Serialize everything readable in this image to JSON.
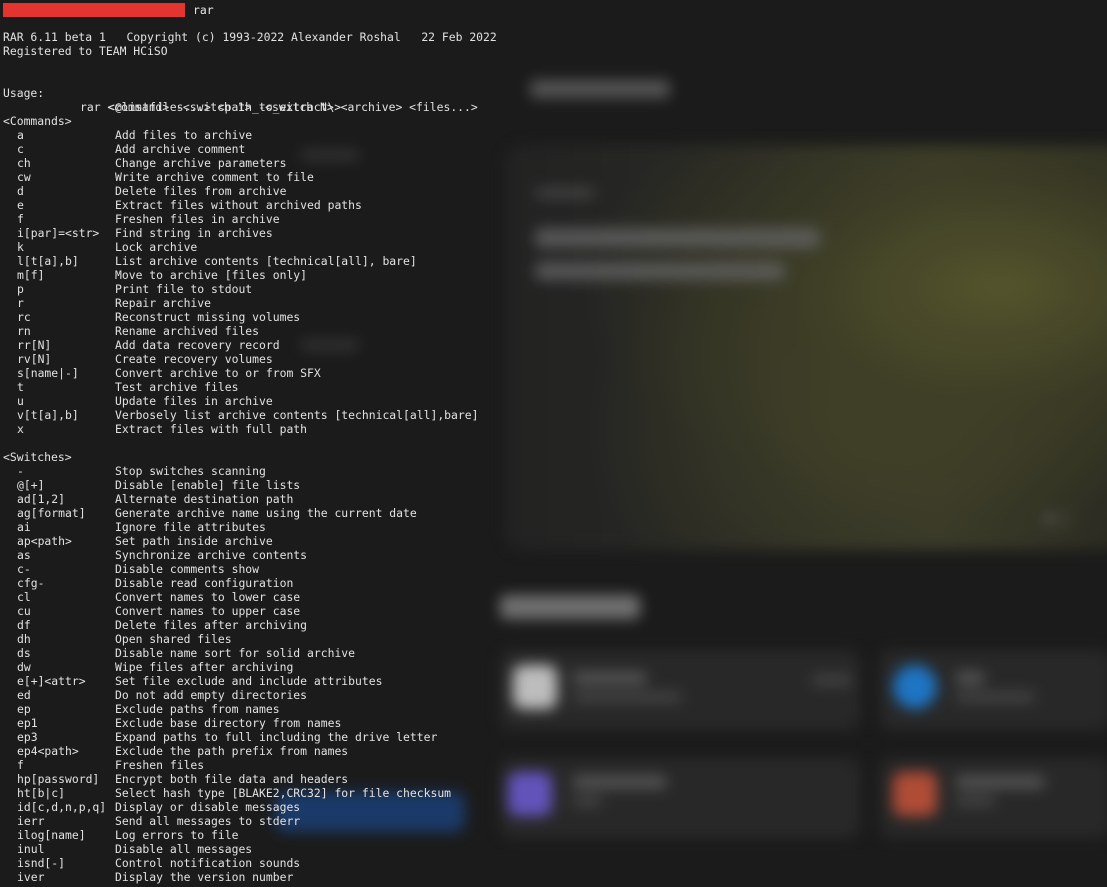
{
  "prompt": {
    "command": "rar"
  },
  "header": {
    "version_line": "RAR 6.11 beta 1   Copyright (c) 1993-2022 Alexander Roshal   22 Feb 2022",
    "registered_line": "Registered to TEAM HCiSO"
  },
  "usage": {
    "label": "Usage:",
    "line1": "rar <command> -<switch 1> -<switch N> <archive> <files...>",
    "line2": "<@listfiles...> <path_to_extract\\>"
  },
  "commands": {
    "heading": "<Commands>",
    "items": [
      {
        "key": "a",
        "desc": "Add files to archive"
      },
      {
        "key": "c",
        "desc": "Add archive comment"
      },
      {
        "key": "ch",
        "desc": "Change archive parameters"
      },
      {
        "key": "cw",
        "desc": "Write archive comment to file"
      },
      {
        "key": "d",
        "desc": "Delete files from archive"
      },
      {
        "key": "e",
        "desc": "Extract files without archived paths"
      },
      {
        "key": "f",
        "desc": "Freshen files in archive"
      },
      {
        "key": "i[par]=<str>",
        "desc": "Find string in archives"
      },
      {
        "key": "k",
        "desc": "Lock archive"
      },
      {
        "key": "l[t[a],b]",
        "desc": "List archive contents [technical[all], bare]"
      },
      {
        "key": "m[f]",
        "desc": "Move to archive [files only]"
      },
      {
        "key": "p",
        "desc": "Print file to stdout"
      },
      {
        "key": "r",
        "desc": "Repair archive"
      },
      {
        "key": "rc",
        "desc": "Reconstruct missing volumes"
      },
      {
        "key": "rn",
        "desc": "Rename archived files"
      },
      {
        "key": "rr[N]",
        "desc": "Add data recovery record"
      },
      {
        "key": "rv[N]",
        "desc": "Create recovery volumes"
      },
      {
        "key": "s[name|-]",
        "desc": "Convert archive to or from SFX"
      },
      {
        "key": "t",
        "desc": "Test archive files"
      },
      {
        "key": "u",
        "desc": "Update files in archive"
      },
      {
        "key": "v[t[a],b]",
        "desc": "Verbosely list archive contents [technical[all],bare]"
      },
      {
        "key": "x",
        "desc": "Extract files with full path"
      }
    ]
  },
  "switches": {
    "heading": "<Switches>",
    "items": [
      {
        "key": "-",
        "desc": "Stop switches scanning"
      },
      {
        "key": "@[+]",
        "desc": "Disable [enable] file lists"
      },
      {
        "key": "ad[1,2]",
        "desc": "Alternate destination path"
      },
      {
        "key": "ag[format]",
        "desc": "Generate archive name using the current date"
      },
      {
        "key": "ai",
        "desc": "Ignore file attributes"
      },
      {
        "key": "ap<path>",
        "desc": "Set path inside archive"
      },
      {
        "key": "as",
        "desc": "Synchronize archive contents"
      },
      {
        "key": "c-",
        "desc": "Disable comments show"
      },
      {
        "key": "cfg-",
        "desc": "Disable read configuration"
      },
      {
        "key": "cl",
        "desc": "Convert names to lower case"
      },
      {
        "key": "cu",
        "desc": "Convert names to upper case"
      },
      {
        "key": "df",
        "desc": "Delete files after archiving"
      },
      {
        "key": "dh",
        "desc": "Open shared files"
      },
      {
        "key": "ds",
        "desc": "Disable name sort for solid archive"
      },
      {
        "key": "dw",
        "desc": "Wipe files after archiving"
      },
      {
        "key": "e[+]<attr>",
        "desc": "Set file exclude and include attributes"
      },
      {
        "key": "ed",
        "desc": "Do not add empty directories"
      },
      {
        "key": "ep",
        "desc": "Exclude paths from names"
      },
      {
        "key": "ep1",
        "desc": "Exclude base directory from names"
      },
      {
        "key": "ep3",
        "desc": "Expand paths to full including the drive letter"
      },
      {
        "key": "ep4<path>",
        "desc": "Exclude the path prefix from names"
      },
      {
        "key": "f",
        "desc": "Freshen files"
      },
      {
        "key": "hp[password]",
        "desc": "Encrypt both file data and headers"
      },
      {
        "key": "ht[b|c]",
        "desc": "Select hash type [BLAKE2,CRC32] for file checksum"
      },
      {
        "key": "id[c,d,n,p,q]",
        "desc": "Display or disable messages"
      },
      {
        "key": "ierr",
        "desc": "Send all messages to stderr"
      },
      {
        "key": "ilog[name]",
        "desc": "Log errors to file"
      },
      {
        "key": "inul",
        "desc": "Disable all messages"
      },
      {
        "key": "isnd[-]",
        "desc": "Control notification sounds"
      },
      {
        "key": "iver",
        "desc": "Display the version number"
      }
    ]
  }
}
